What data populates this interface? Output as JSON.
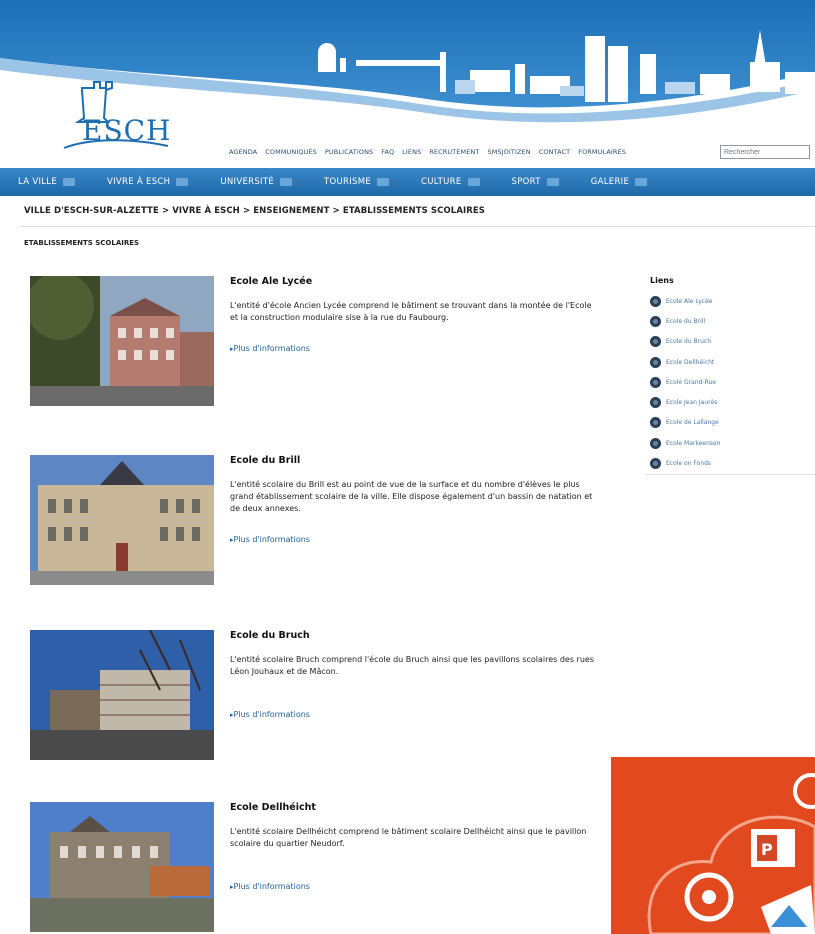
{
  "site": {
    "logo_text": "ESCH",
    "search_placeholder": "Rechercher"
  },
  "topnav": [
    "Agenda",
    "Communiqués",
    "Publications",
    "FAQ",
    "Liens",
    "Recrutement",
    "Smsjoitizen",
    "Contact",
    "Formulaires"
  ],
  "mainnav": [
    "LA VILLE",
    "VIVRE À ESCH",
    "UNIVERSITÉ",
    "TOURISME",
    "CULTURE",
    "SPORT",
    "GALERIE"
  ],
  "breadcrumb": [
    "VILLE D'ESCH-SUR-ALZETTE",
    "VIVRE À ESCH",
    "ENSEIGNEMENT",
    "ETABLISSEMENTS SCOLAIRES"
  ],
  "breadcrumb_sep": ">",
  "page_title": "ETABLISSEMENTS SCOLAIRES",
  "schools": [
    {
      "name": "Ecole Ale Lycée",
      "description": "L'entité d'école Ancien Lycée comprend le bâtiment se trouvant dans la montée de l'Ecole et la construction modulaire sise à la rue du Faubourg.",
      "more": "Plus d'informations"
    },
    {
      "name": "Ecole du Brill",
      "description": "L'entité scolaire du Brill est au point de vue de la surface et du nombre d'élèves le plus grand établissement scolaire de la ville. Elle dispose également d'un bassin de natation et de deux annexes.",
      "more": "Plus d'informations"
    },
    {
      "name": "Ecole du Bruch",
      "description": "L'entité scolaire Bruch comprend l'école du Bruch ainsi que les pavillons scolaires des rues Léon Jouhaux et de Mâcon.",
      "more": "Plus d'informations"
    },
    {
      "name": "Ecole Dellhéicht",
      "description": "L'entité scolaire Dellhéicht comprend le bâtiment scolaire Dellhéicht ainsi que le pavillon scolaire du quartier Neudorf.",
      "more": "Plus d'informations"
    }
  ],
  "sidebar": {
    "title": "Liens",
    "links": [
      "Ecole Ale Lycée",
      "Ecole du Brill",
      "Ecole du Bruch",
      "Ecole Dellhéicht",
      "Ecole Grand-Rue",
      "Ecole Jean Jaurès",
      "Ecole de Lallange",
      "Ecole Markeensen",
      "Ecole on Fonds"
    ]
  },
  "colors": {
    "nav_blue": "#1e67a8",
    "link_blue": "#1f5f98",
    "office_orange": "#e2491f"
  }
}
